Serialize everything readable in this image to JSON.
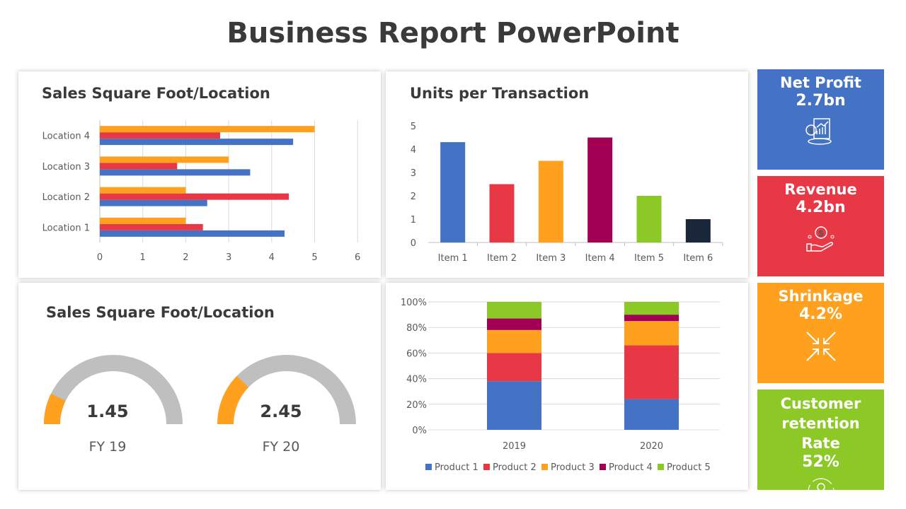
{
  "title": "Business Report PowerPoint",
  "colors": {
    "blue": "#4472C4",
    "red": "#E83845",
    "orange": "#FFA01E",
    "purple": "#A10054",
    "green": "#8CC826",
    "navy": "#1A2639",
    "gray": "#BFBFBF"
  },
  "chart_data": [
    {
      "type": "bar",
      "orientation": "horizontal",
      "title": "Sales Square Foot/Location",
      "categories": [
        "Location 1",
        "Location 2",
        "Location 3",
        "Location 4"
      ],
      "series": [
        {
          "color": "#4472C4",
          "values": [
            4.3,
            2.5,
            3.5,
            4.5
          ]
        },
        {
          "color": "#E83845",
          "values": [
            2.4,
            4.4,
            1.8,
            2.8
          ]
        },
        {
          "color": "#FFA01E",
          "values": [
            2,
            2,
            3,
            5
          ]
        }
      ],
      "xlim": [
        0,
        6
      ],
      "xticks": [
        "0",
        "1",
        "2",
        "3",
        "4",
        "5",
        "6"
      ],
      "grid": true
    },
    {
      "type": "bar",
      "title": "Units per Transaction",
      "categories": [
        "Item 1",
        "Item 2",
        "Item 3",
        "Item 4",
        "Item 5",
        "Item 6"
      ],
      "values": [
        4.3,
        2.5,
        3.5,
        4.5,
        2,
        1
      ],
      "colors": [
        "#4472C4",
        "#E83845",
        "#FFA01E",
        "#A10054",
        "#8CC826",
        "#1A2639"
      ],
      "ylim": [
        0,
        5
      ],
      "yticks": [
        "0",
        "1",
        "2",
        "3",
        "4",
        "5"
      ],
      "grid": false
    },
    {
      "type": "gauge",
      "title": "Sales Square Foot/Location",
      "gauges": [
        {
          "value": "1.45",
          "label": "FY 19",
          "fraction": 0.145
        },
        {
          "value": "2.45",
          "label": "FY 20",
          "fraction": 0.245
        }
      ]
    },
    {
      "type": "bar",
      "stacked": "percent",
      "categories": [
        "2019",
        "2020"
      ],
      "series": [
        {
          "name": "Product 1",
          "color": "#4472C4",
          "values": [
            38,
            24
          ]
        },
        {
          "name": "Product 2",
          "color": "#E83845",
          "values": [
            22,
            42
          ]
        },
        {
          "name": "Product 3",
          "color": "#FFA01E",
          "values": [
            18,
            19
          ]
        },
        {
          "name": "Product 4",
          "color": "#A10054",
          "values": [
            9,
            5
          ]
        },
        {
          "name": "Product 5",
          "color": "#8CC826",
          "values": [
            13,
            10
          ]
        }
      ],
      "ylim": [
        0,
        100
      ],
      "yticks": [
        "0%",
        "20%",
        "40%",
        "60%",
        "80%",
        "100%"
      ],
      "grid": true,
      "legend": "bottom"
    }
  ],
  "kpis": [
    {
      "label": "Net Profit",
      "value": "2.7bn",
      "color": "#4472C4",
      "icon": "financial-report-icon"
    },
    {
      "label": "Revenue",
      "value": "4.2bn",
      "color": "#E83845",
      "icon": "hand-coin-icon"
    },
    {
      "label": "Shrinkage",
      "value": "4.2%",
      "color": "#FFA01E",
      "icon": "shrink-arrows-icon"
    },
    {
      "label": "Customer retention Rate",
      "value": "52%",
      "color": "#8CC826",
      "icon": "customer-cycle-icon"
    }
  ]
}
